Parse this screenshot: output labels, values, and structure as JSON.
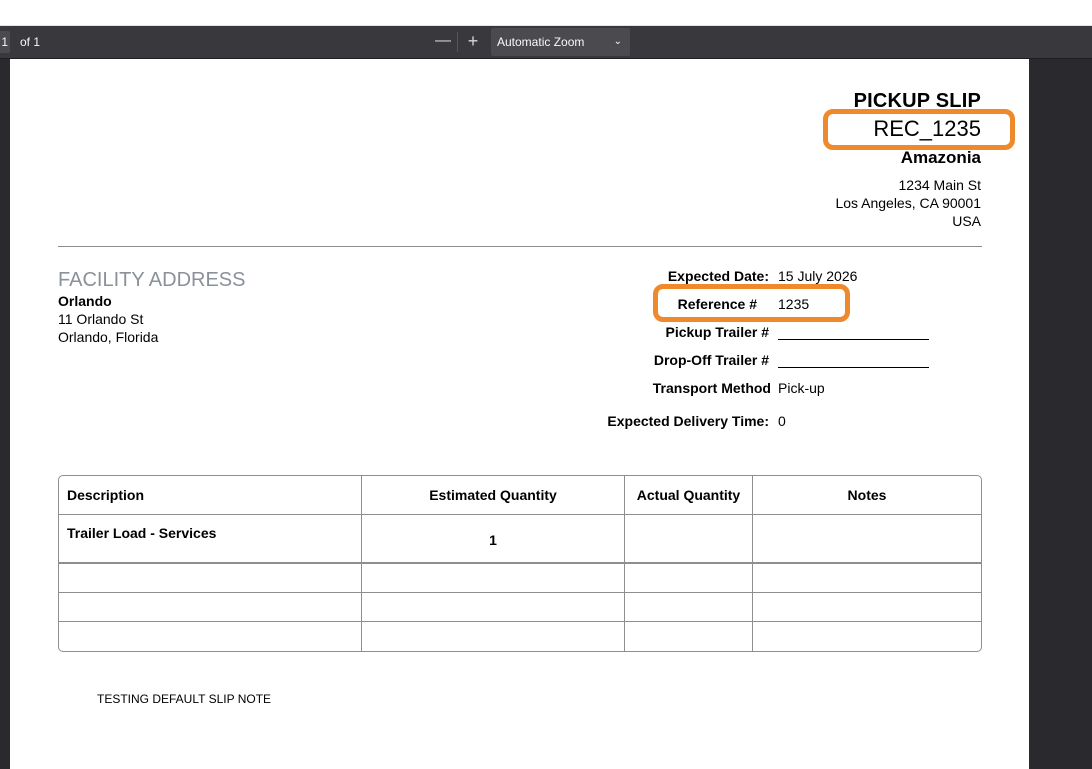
{
  "toolbar": {
    "page_number": "1",
    "page_count": "of 1",
    "zoom_out_glyph": "—",
    "zoom_in_glyph": "+",
    "zoom_label": "Automatic Zoom",
    "zoom_chevron": "⌄"
  },
  "slip": {
    "title": "PICKUP SLIP",
    "number": "REC_1235",
    "company_name": "Amazonia",
    "company_address": [
      "1234 Main St",
      "Los Angeles, CA 90001",
      "USA"
    ]
  },
  "facility": {
    "heading": "FACILITY ADDRESS",
    "name": "Orlando",
    "street": "11 Orlando St",
    "city": "Orlando, Florida"
  },
  "fields": {
    "expected_date_label": "Expected Date:",
    "expected_date_value": "15 July 2026",
    "reference_label": "Reference #",
    "reference_value": "1235",
    "pickup_trailer_label": "Pickup Trailer #",
    "dropoff_trailer_label": "Drop-Off Trailer #",
    "transport_method_label": "Transport Method",
    "transport_method_value": "Pick-up",
    "expected_delivery_label": "Expected Delivery Time:",
    "expected_delivery_value": "0"
  },
  "table": {
    "headers": [
      "Description",
      "Estimated Quantity",
      "Actual Quantity",
      "Notes"
    ],
    "rows": [
      [
        "Trailer Load - Services",
        "1",
        "",
        ""
      ]
    ]
  },
  "note": "TESTING DEFAULT SLIP NOTE",
  "colors": {
    "highlight": "#ef8a2c",
    "toolbar_bg": "#38383d",
    "viewer_bg": "#2a2a2e"
  }
}
